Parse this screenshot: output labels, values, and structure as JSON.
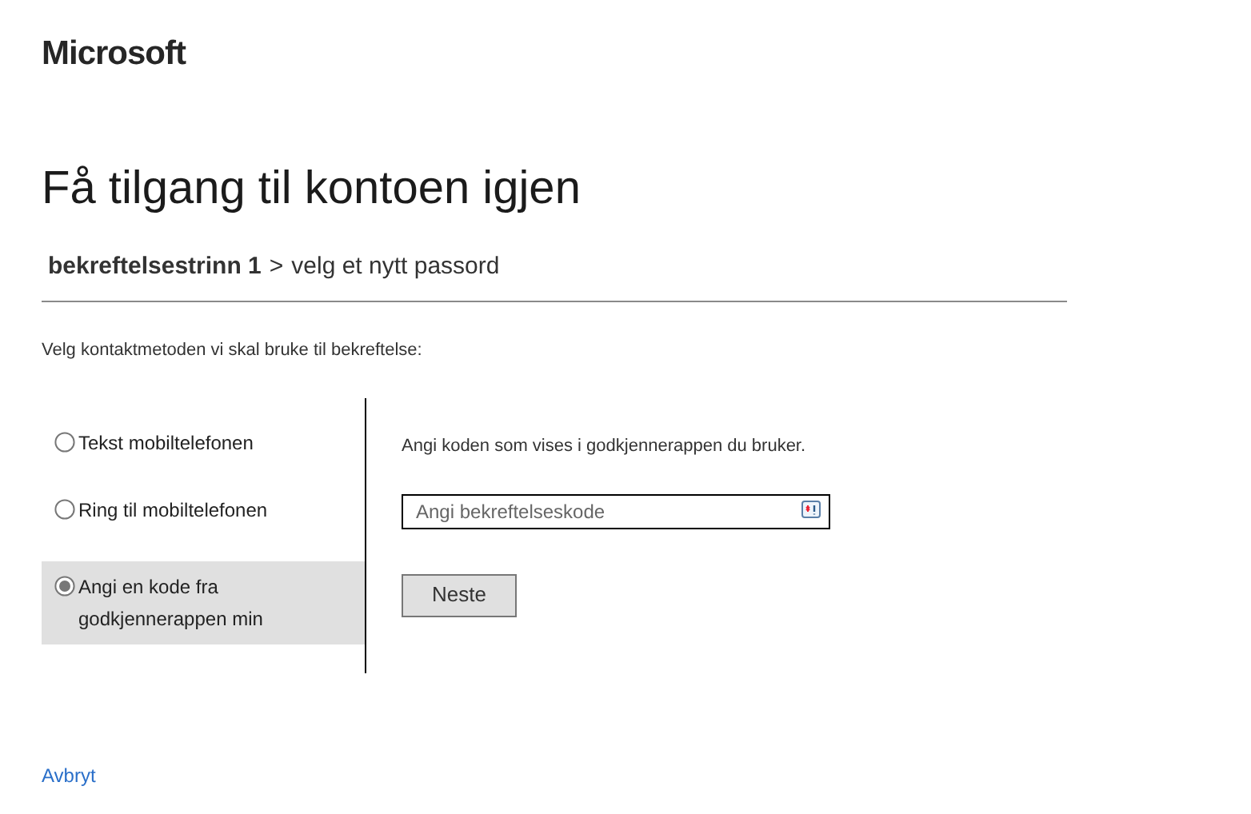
{
  "logo": "Microsoft",
  "title": "Få tilgang til kontoen igjen",
  "breadcrumb": {
    "current": "bekreftelsestrinn 1",
    "separator": ">",
    "next": "velg et nytt passord"
  },
  "instruction": "Velg kontaktmetoden vi skal bruke til bekreftelse:",
  "methods": [
    {
      "label": "Tekst mobiltelefonen",
      "selected": false
    },
    {
      "label": "Ring til mobiltelefonen",
      "selected": false
    },
    {
      "label": "Angi en kode fra godkjennerappen min",
      "selected": true
    }
  ],
  "prompt": "Angi koden som vises i godkjennerappen du bruker.",
  "code_field": {
    "placeholder": "Angi bekreftelseskode"
  },
  "next_button": "Neste",
  "cancel_link": "Avbryt"
}
